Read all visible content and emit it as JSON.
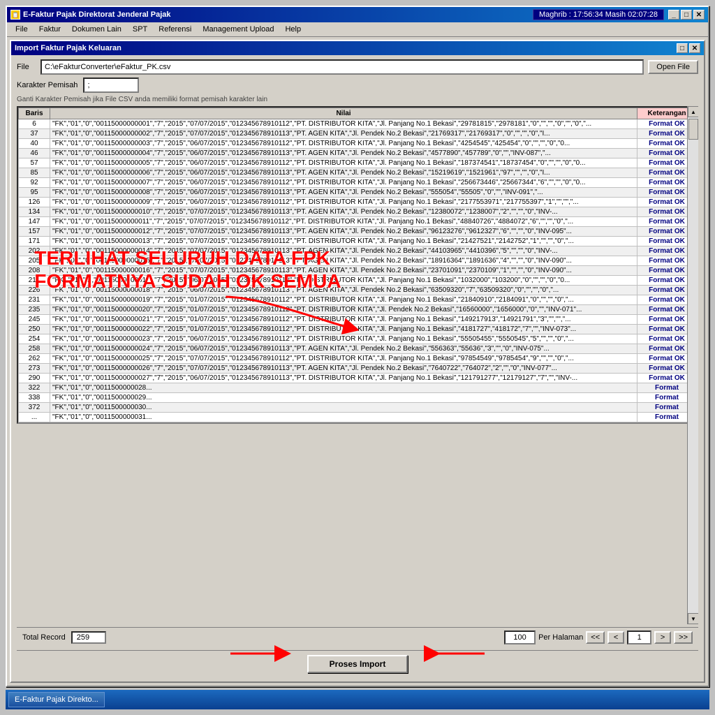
{
  "app": {
    "title": "E-Faktur Pajak Direktorat Jenderal Pajak",
    "clock": "Maghrib : 17:56:34  Masih 02:07:28",
    "menu": [
      "File",
      "Faktur",
      "Dokumen Lain",
      "SPT",
      "Referensi",
      "Management Upload",
      "Help"
    ]
  },
  "dialog": {
    "title": "Import Faktur Pajak Keluaran",
    "file_label": "File",
    "file_path": "C:\\eFakturConverter\\eFaktur_PK.csv",
    "open_file_btn": "Open File",
    "separator_label": "Karakter Pemisah",
    "separator_value": ";",
    "hint": "Ganti Karakter Pemisah jika File CSV anda memiliki format pemisah karakter lain"
  },
  "table": {
    "headers": [
      "Baris",
      "Nilai",
      "Keterangan"
    ],
    "rows": [
      {
        "baris": "6",
        "nilai": "\"FK\",\"01\",\"0\",\"00115000000001\",\"7\",\"2015\",\"07/07/2015\",\"012345678910112\",\"PT. DISTRIBUTOR KITA\",\"Jl. Panjang No.1 Bekasi\",\"29781815\",\"2978181\",\"0\",\"\",\"\",\"0\",\"\",\"0\",\"...",
        "ket": "Format OK"
      },
      {
        "baris": "37",
        "nilai": "\"FK\",\"01\",\"0\",\"00115000000002\",\"7\",\"2015\",\"07/07/2015\",\"012345678910113\",\"PT. AGEN KITA\",\"Jl. Pendek No.2 Bekasi\",\"21769317\",\"21769317\",\"0\",\"\",\"\",\"0\",\"I...",
        "ket": "Format OK"
      },
      {
        "baris": "40",
        "nilai": "\"FK\",\"01\",\"0\",\"00115000000003\",\"7\",\"2015\",\"06/07/2015\",\"012345678910112\",\"PT. DISTRIBUTOR KITA\",\"Jl. Panjang No.1 Bekasi\",\"4254545\",\"425454\",\"0\",\"\",\"\",\"0\",\"0...",
        "ket": "Format OK"
      },
      {
        "baris": "46",
        "nilai": "\"FK\",\"01\",\"0\",\"00115000000004\",\"7\",\"2015\",\"06/07/2015\",\"012345678910113\",\"PT. AGEN KITA\",\"Jl. Pendek No.2 Bekasi\",\"4577890\",\"457789\",\"0\",\"\",\"INV-087\",\"...",
        "ket": "Format OK"
      },
      {
        "baris": "57",
        "nilai": "\"FK\",\"01\",\"0\",\"00115000000005\",\"7\",\"2015\",\"06/07/2015\",\"012345678910112\",\"PT. DISTRIBUTOR KITA\",\"Jl. Panjang No.1 Bekasi\",\"187374541\",\"18737454\",\"0\",\"\",\"\",\"0\",\"0...",
        "ket": "Format OK"
      },
      {
        "baris": "85",
        "nilai": "\"FK\",\"01\",\"0\",\"00115000000006\",\"7\",\"2015\",\"06/07/2015\",\"012345678910113\",\"PT. AGEN KITA\",\"Jl. Pendek No.2 Bekasi\",\"15219619\",\"1521961\",\"97\",\"\",\"\",\"0\",\"I...",
        "ket": "Format OK"
      },
      {
        "baris": "92",
        "nilai": "\"FK\",\"01\",\"0\",\"00115000000007\",\"7\",\"2015\",\"06/07/2015\",\"012345678910112\",\"PT. DISTRIBUTOR KITA\",\"Jl. Panjang No.1 Bekasi\",\"256673446\",\"25667344\",\"6\",\"\",\"\",\"0\",\"0...",
        "ket": "Format OK"
      },
      {
        "baris": "95",
        "nilai": "\"FK\",\"01\",\"0\",\"00115000000008\",\"7\",\"2015\",\"06/07/2015\",\"012345678910113\",\"PT. AGEN KITA\",\"Jl. Pendek No.2 Bekasi\",\"555054\",\"55505\",\"0\",\"\",\"INV-091\",\"...",
        "ket": "Format OK"
      },
      {
        "baris": "126",
        "nilai": "\"FK\",\"01\",\"0\",\"00115000000009\",\"7\",\"2015\",\"06/07/2015\",\"012345678910112\",\"PT. DISTRIBUTOR KITA\",\"Jl. Panjang No.1 Bekasi\",\"2177553971\",\"217755397\",\"1\",\"\",\"\",\"...",
        "ket": "Format OK"
      },
      {
        "baris": "134",
        "nilai": "\"FK\",\"01\",\"0\",\"00115000000010\",\"7\",\"2015\",\"07/07/2015\",\"012345678910113\",\"PT. AGEN KITA\",\"Jl. Pendek No.2 Bekasi\",\"12380072\",\"1238007\",\"2\",\"\",\"\",\"0\",\"INV-...",
        "ket": "Format OK"
      },
      {
        "baris": "147",
        "nilai": "\"FK\",\"01\",\"0\",\"00115000000011\",\"7\",\"2015\",\"07/07/2015\",\"012345678910112\",\"PT. DISTRIBUTOR KITA\",\"Jl. Panjang No.1 Bekasi\",\"48840726\",\"4884072\",\"6\",\"\",\"\",\"0\",\"...",
        "ket": "Format OK"
      },
      {
        "baris": "157",
        "nilai": "\"FK\",\"01\",\"0\",\"00115000000012\",\"7\",\"2015\",\"07/07/2015\",\"012345678910113\",\"PT. AGEN KITA\",\"Jl. Pendek No.2 Bekasi\",\"96123276\",\"9612327\",\"6\",\"\",\"\",\"0\",\"INV-095\"...",
        "ket": "Format OK"
      },
      {
        "baris": "171",
        "nilai": "\"FK\",\"01\",\"0\",\"00115000000013\",\"7\",\"2015\",\"07/07/2015\",\"012345678910112\",\"PT. DISTRIBUTOR KITA\",\"Jl. Panjang No.1 Bekasi\",\"21427521\",\"2142752\",\"1\",\"\",\"\",\"0\",\"...",
        "ket": "Format OK"
      },
      {
        "baris": "202",
        "nilai": "\"FK\",\"01\",\"0\",\"00115000000014\",\"7\",\"2015\",\"07/07/2015\",\"012345678910113\",\"PT. AGEN KITA\",\"Jl. Pendek No.2 Bekasi\",\"44103965\",\"4410396\",\"5\",\"\",\"\",\"0\",\"INV-...",
        "ket": "Format OK"
      },
      {
        "baris": "205",
        "nilai": "\"FK\",\"01\",\"0\",\"00115000000015\",\"7\",\"2015\",\"07/07/2015\",\"012345678910113\",\"PT. AGEN KITA\",\"Jl. Pendek No.2 Bekasi\",\"18916364\",\"1891636\",\"4\",\"\",\"\",\"0\",\"INV-090\"...",
        "ket": "Format OK"
      },
      {
        "baris": "208",
        "nilai": "\"FK\",\"01\",\"0\",\"00115000000016\",\"7\",\"2015\",\"07/07/2015\",\"012345678910113\",\"PT. AGEN KITA\",\"Jl. Pendek No.2 Bekasi\",\"23701091\",\"2370109\",\"1\",\"\",\"\",\"0\",\"INV-090\"...",
        "ket": "Format OK"
      },
      {
        "baris": "214",
        "nilai": "\"FK\",\"01\",\"0\",\"00115000000017\",\"7\",\"2015\",\"06/07/2015\",\"012345678910112\",\"PT. DISTRIBUTOR KITA\",\"Jl. Panjang No.1 Bekasi\",\"1032000\",\"103200\",\"0\",\"\",\"\",\"0\",\"0...",
        "ket": "Format OK"
      },
      {
        "baris": "226",
        "nilai": "\"FK\",\"01\",\"0\",\"00115000000018\",\"7\",\"2015\",\"06/07/2015\",\"012345678910113\",\"PT. AGEN KITA\",\"Jl. Pendek No.2 Bekasi\",\"63509320\",\"7\",\"63509320\",\"0\",\"\",\"\",\"0\",\"...",
        "ket": "Format OK"
      },
      {
        "baris": "231",
        "nilai": "\"FK\",\"01\",\"0\",\"00115000000019\",\"7\",\"2015\",\"01/07/2015\",\"012345678910112\",\"PT. DISTRIBUTOR KITA\",\"Jl. Panjang No.1 Bekasi\",\"21840910\",\"2184091\",\"0\",\"\",\"\",\"0\",\"...",
        "ket": "Format OK"
      },
      {
        "baris": "235",
        "nilai": "\"FK\",\"01\",\"0\",\"00115000000020\",\"7\",\"2015\",\"01/07/2015\",\"012345678910112\",\"PT. DISTRIBUTOR KITA\",\"Jl. Pendek No.2 Bekasi\",\"16560000\",\"1656000\",\"0\",\"\",\"INV-071\"...",
        "ket": "Format OK"
      },
      {
        "baris": "245",
        "nilai": "\"FK\",\"01\",\"0\",\"00115000000021\",\"7\",\"2015\",\"01/07/2015\",\"012345678910112\",\"PT. DISTRIBUTOR KITA\",\"Jl. Panjang No.1 Bekasi\",\"149217913\",\"14921791\",\"3\",\"\",\"\",\"...",
        "ket": "Format OK"
      },
      {
        "baris": "250",
        "nilai": "\"FK\",\"01\",\"0\",\"00115000000022\",\"7\",\"2015\",\"01/07/2015\",\"012345678910112\",\"PT. DISTRIBUTOR KITA\",\"Jl. Panjang No.1 Bekasi\",\"4181727\",\"418172\",\"7\",\"\",\"INV-073\"...",
        "ket": "Format OK"
      },
      {
        "baris": "254",
        "nilai": "\"FK\",\"01\",\"0\",\"00115000000023\",\"7\",\"2015\",\"06/07/2015\",\"012345678910112\",\"PT. DISTRIBUTOR KITA\",\"Jl. Panjang No.1 Bekasi\",\"55505455\",\"5550545\",\"5\",\"\",\"\",\"0\",\"...",
        "ket": "Format OK"
      },
      {
        "baris": "258",
        "nilai": "\"FK\",\"01\",\"0\",\"00115000000024\",\"7\",\"2015\",\"06/07/2015\",\"012345678910113\",\"PT. AGEN KITA\",\"Jl. Pendek No.2 Bekasi\",\"556363\",\"55636\",\"3\",\"\",\"0\",\"INV-075\"...",
        "ket": "Format OK"
      },
      {
        "baris": "262",
        "nilai": "\"FK\",\"01\",\"0\",\"00115000000025\",\"7\",\"2015\",\"07/07/2015\",\"012345678910112\",\"PT. DISTRIBUTOR KITA\",\"Jl. Panjang No.1 Bekasi\",\"97854549\",\"9785454\",\"9\",\"\",\"\",\"0\",\"...",
        "ket": "Format OK"
      },
      {
        "baris": "273",
        "nilai": "\"FK\",\"01\",\"0\",\"00115000000026\",\"7\",\"2015\",\"07/07/2015\",\"012345678910113\",\"PT. AGEN KITA\",\"Jl. Pendek No.2 Bekasi\",\"7640722\",\"764072\",\"2\",\"\",\"0\",\"INV-077\"...",
        "ket": "Format OK"
      },
      {
        "baris": "290",
        "nilai": "\"FK\",\"01\",\"0\",\"00115000000027\",\"7\",\"2015\",\"06/07/2015\",\"012345678910113\",\"PT. DISTRIBUTOR KITA\",\"Jl. Panjang No.1 Bekasi\",\"121791277\",\"12179127\",\"7\",\"\",\"INV-...",
        "ket": "Format OK"
      },
      {
        "baris": "322",
        "nilai": "\"FK\",\"01\",\"0\",\"0011500000028...",
        "ket": "Format"
      },
      {
        "baris": "338",
        "nilai": "\"FK\",\"01\",\"0\",\"0011500000029...",
        "ket": "Format"
      },
      {
        "baris": "372",
        "nilai": "\"FK\",\"01\",\"0\",\"0011500000030...",
        "ket": "Format"
      },
      {
        "baris": "...",
        "nilai": "\"FK\",\"01\",\"0\",\"0011500000031...",
        "ket": "Format"
      }
    ]
  },
  "overlay": {
    "line1": "TERLIHAT SELURUH DATA FPK",
    "line2": "FORMATNYA SUDAH OK SEMUA"
  },
  "bottom": {
    "total_label": "Total Record",
    "total_value": "259",
    "per_halaman_label": "Per Halaman",
    "per_halaman_value": "100",
    "nav_first": "<<",
    "nav_prev": "<",
    "page_value": "1",
    "nav_next": ">",
    "nav_last": ">>"
  },
  "import_btn": "Proses Import",
  "taskbar": {
    "item": "E-Faktur Pajak Direkto..."
  }
}
